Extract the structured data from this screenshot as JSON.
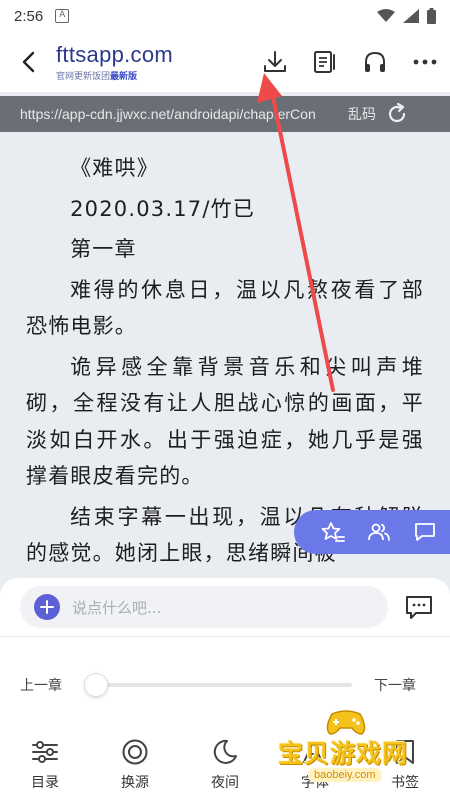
{
  "status": {
    "time": "2:56",
    "app_badge": "A"
  },
  "header": {
    "logo": "fttsapp.com",
    "logo_sub": "官网更新饭团",
    "logo_sub_highlight": "最新版"
  },
  "url_bar": {
    "url": "https://app-cdn.jjwxc.net/androidapi/chapterCon",
    "garbled_label": "乱码"
  },
  "content": {
    "paragraphs": [
      "《难哄》",
      "2020.03.17/竹已",
      "第一章",
      "难得的休息日，温以凡熬夜看了部恐怖电影。",
      "诡异感全靠背景音乐和尖叫声堆砌，全程没有让人胆战心惊的画面，平淡如白开水。出于强迫症，她几乎是强撑着眼皮看完的。",
      "结束字幕一出现，温以凡有种解脱的感觉。她闭上眼，思绪瞬间被"
    ]
  },
  "comment": {
    "placeholder": "说点什么吧..."
  },
  "chapter_nav": {
    "prev": "上一章",
    "next": "下一章",
    "progress": 0
  },
  "tabs": [
    {
      "label": "目录",
      "icon": "catalog-icon"
    },
    {
      "label": "换源",
      "icon": "switch-source-icon"
    },
    {
      "label": "夜间",
      "icon": "moon-icon"
    },
    {
      "label": "字体",
      "icon": "font-icon"
    },
    {
      "label": "书签",
      "icon": "bookmark-icon"
    }
  ],
  "watermark": {
    "text": "宝贝游戏网",
    "url": "baobeiy.com"
  },
  "colors": {
    "accent": "#6a78e8",
    "logo": "#2b3a8c",
    "url_bar": "#6b6f75",
    "arrow": "#ee4a4a",
    "page_bg": "#e9edf1"
  }
}
